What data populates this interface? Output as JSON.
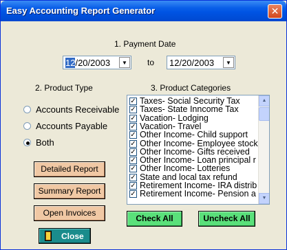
{
  "window": {
    "title": "Easy Accounting Report Generator",
    "close_glyph": "✕"
  },
  "payment_date": {
    "heading": "1. Payment Date",
    "from": {
      "selected": "12",
      "rest": "/20/2003"
    },
    "to_label": "to",
    "to": {
      "value": "12/20/2003"
    }
  },
  "product_type": {
    "heading": "2. Product Type",
    "options": [
      {
        "label": "Accounts Receivable",
        "selected": false
      },
      {
        "label": "Accounts Payable",
        "selected": false
      },
      {
        "label": "Both",
        "selected": true
      }
    ]
  },
  "actions": {
    "detailed": "Detailed Report",
    "summary": "Summary Report",
    "open_invoices": "Open Invoices",
    "close": "Close"
  },
  "categories": {
    "heading": "3. Product Categories",
    "items": [
      {
        "label": "Taxes- Social Security Tax",
        "checked": true
      },
      {
        "label": "Taxes- State Inncome Tax",
        "checked": true
      },
      {
        "label": "Vacation- Lodging",
        "checked": true
      },
      {
        "label": "Vacation- Travel",
        "checked": true
      },
      {
        "label": "Other Income- Child support",
        "checked": true
      },
      {
        "label": "Other Income- Employee stock",
        "checked": true
      },
      {
        "label": "Other Income- Gifts received",
        "checked": true
      },
      {
        "label": "Other Income- Loan principal r",
        "checked": true
      },
      {
        "label": "Other Income- Lotteries",
        "checked": true
      },
      {
        "label": "State and local tax refund",
        "checked": true
      },
      {
        "label": "Retirement Income- IRA distrib",
        "checked": true
      },
      {
        "label": "Retirement Income- Pension a",
        "checked": true
      }
    ],
    "check_all": "Check All",
    "uncheck_all": "Uncheck All"
  },
  "colors": {
    "window_bg": "#ECE9D8",
    "report_button": "#F0C8A4",
    "check_button": "#5AE07A",
    "close_button": "#1A8C8C"
  }
}
